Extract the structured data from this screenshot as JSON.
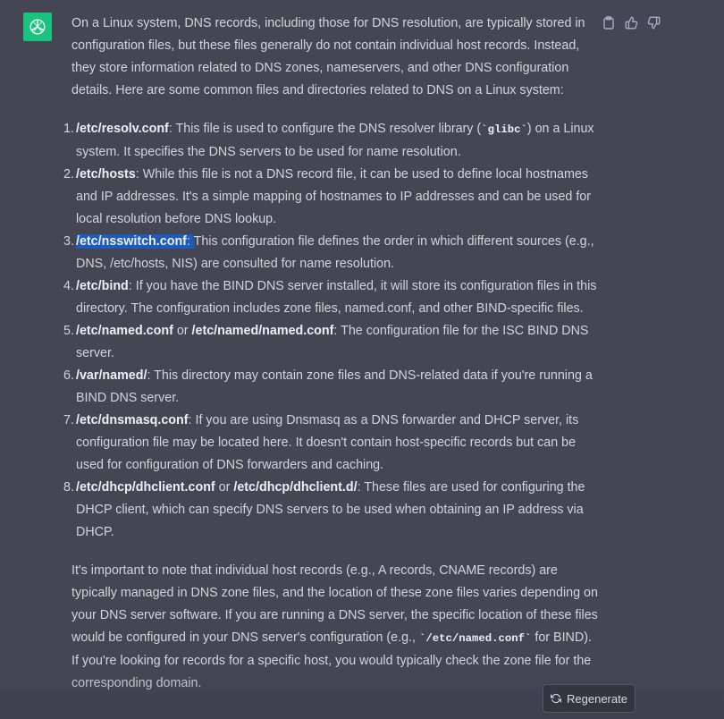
{
  "icons": {
    "avatar": "openai-logo-icon",
    "copy": "clipboard-icon",
    "like": "thumbs-up-icon",
    "dislike": "thumbs-down-icon",
    "regenerate": "refresh-icon"
  },
  "colors": {
    "background": "#444654",
    "avatar_bg": "#19c37d",
    "text": "#d1d5db",
    "selection": "#1f5bb8"
  },
  "message": {
    "intro": "On a Linux system, DNS records, including those for DNS resolution, are typically stored in configuration files, but these files generally do not contain individual host records. Instead, they store information related to DNS zones, nameservers, and other DNS configuration details. Here are some common files and directories related to DNS on a Linux system:",
    "items": [
      {
        "num": "1.",
        "title": "/etc/resolv.conf",
        "t1": ": This file is used to configure the DNS resolver library (",
        "code": "`glibc`",
        "t2": ") on a Linux system. It specifies the DNS servers to be used for name resolution."
      },
      {
        "num": "2.",
        "title": "/etc/hosts",
        "text": ": While this file is not a DNS record file, it can be used to define local hostnames and IP addresses. It's a simple mapping of hostnames to IP addresses and can be used for local resolution before DNS lookup."
      },
      {
        "num": "3.",
        "title": "/etc/nsswitch.conf",
        "sel_colon": ": ",
        "text": "This configuration file defines the order in which different sources (e.g., DNS, /etc/hosts, NIS) are consulted for name resolution."
      },
      {
        "num": "4.",
        "title": "/etc/bind",
        "text": ": If you have the BIND DNS server installed, it will store its configuration files in this directory. The configuration includes zone files, named.conf, and other BIND-specific files."
      },
      {
        "num": "5.",
        "title": "/etc/named.conf",
        "or": " or ",
        "title2": "/etc/named/named.conf",
        "text": ": The configuration file for the ISC BIND DNS server."
      },
      {
        "num": "6.",
        "title": "/var/named/",
        "text": ": This directory may contain zone files and DNS-related data if you're running a BIND DNS server."
      },
      {
        "num": "7.",
        "title": "/etc/dnsmasq.conf",
        "text": ": If you are using Dnsmasq as a DNS forwarder and DHCP server, its configuration file may be located here. It doesn't contain host-specific records but can be used for configuration of DNS forwarders and caching."
      },
      {
        "num": "8.",
        "title": "/etc/dhcp/dhclient.conf",
        "or": " or ",
        "title2": "/etc/dhcp/dhclient.d/",
        "text": ": These files are used for configuring the DHCP client, which can specify DNS servers to be used when obtaining an IP address via DHCP."
      }
    ],
    "outro_1": "It's important to note that individual host records (e.g., A records, CNAME records) are typically managed in DNS zone files, and the location of these zone files varies depending on your DNS server software. If you are running a DNS server, the specific location of these files would be configured in your DNS server's configuration (e.g., ",
    "outro_code": "`/etc/named.conf`",
    "outro_2": " for BIND). If you're looking for records for a specific host, you would typically check the zone file for the corresponding domain."
  },
  "regenerate_label": "Regenerate"
}
